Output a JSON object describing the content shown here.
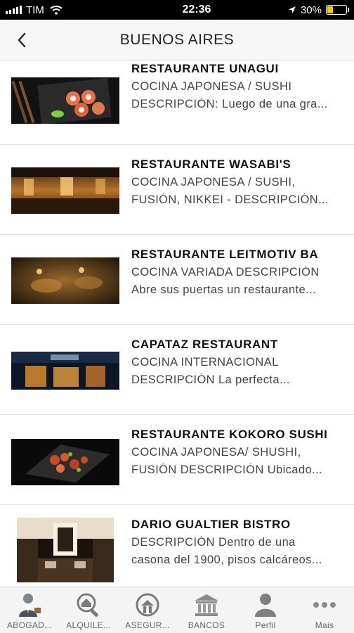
{
  "status_bar": {
    "carrier": "TIM",
    "time": "22:36",
    "battery": "30%",
    "battery_level": 0.3
  },
  "nav": {
    "title": "BUENOS AIRES",
    "back_icon": "chevron-left-icon"
  },
  "restaurants": [
    {
      "name": "RESTAURANTE UNAGUI",
      "line1": "COCINA JAPONESA / SUSHI",
      "line2": "DESCRIPCIÓN: Luego de una gra..."
    },
    {
      "name": "RESTAURANTE WASABI'S",
      "line1": "COCINA JAPONESA / SUSHI,",
      "line2": "FUSIÓN, NIKKEI - DESCRIPCIÓN..."
    },
    {
      "name": "RESTAURANTE LEITMOTIV BA",
      "line1": "COCINA VARIADA DESCRIPCIÓN",
      "line2": "Abre sus puertas un restaurante..."
    },
    {
      "name": "CAPATAZ RESTAURANT",
      "line1": "COCINA INTERNACIONAL",
      "line2": "DESCRIPCIÓN La perfecta..."
    },
    {
      "name": "RESTAURANTE KOKORO SUSHI",
      "line1": "COCINA JAPONESA/ SHUSHI,",
      "line2": "FUSIÓN DESCRIPCIÓN Ubicado..."
    },
    {
      "name": "DARIO GUALTIER BISTRO",
      "line1": "DESCRIPCIÓN Dentro de una",
      "line2": "casona del 1900, pisos calcáreos..."
    }
  ],
  "tabs": [
    {
      "label": "ABOGAD...",
      "icon": "lawyer-icon"
    },
    {
      "label": "ALQUILE...",
      "icon": "house-search-icon"
    },
    {
      "label": "ASEGUR...",
      "icon": "insurance-icon"
    },
    {
      "label": "BANCOS",
      "icon": "bank-icon"
    },
    {
      "label": "Perfil",
      "icon": "profile-icon"
    },
    {
      "label": "Mais",
      "icon": "more-icon"
    }
  ]
}
